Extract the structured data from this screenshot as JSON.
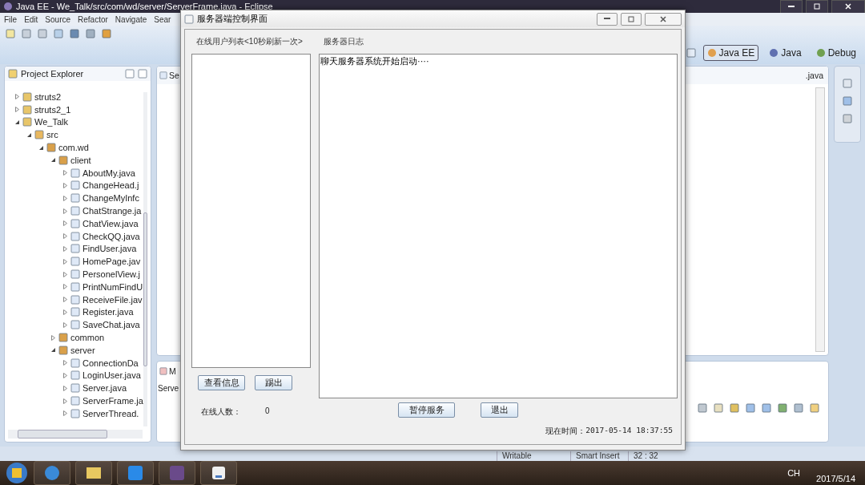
{
  "window": {
    "title": "Java EE - We_Talk/src/com/wd/server/ServerFrame.java - Eclipse"
  },
  "menu": [
    "File",
    "Edit",
    "Source",
    "Refactor",
    "Navigate",
    "Sear"
  ],
  "perspectives": [
    {
      "label": "Java EE",
      "selected": true
    },
    {
      "label": "Java",
      "selected": false
    },
    {
      "label": "Debug",
      "selected": false
    }
  ],
  "project_explorer": {
    "title": "Project Explorer",
    "tree": [
      {
        "label": "struts2",
        "kind": "project",
        "expanded": false
      },
      {
        "label": "struts2_1",
        "kind": "project",
        "expanded": false
      },
      {
        "label": "We_Talk",
        "kind": "project",
        "expanded": true,
        "children": [
          {
            "label": "src",
            "kind": "source",
            "expanded": true,
            "children": [
              {
                "label": "com.wd",
                "kind": "package",
                "expanded": true,
                "children": [
                  {
                    "label": "client",
                    "kind": "package",
                    "expanded": true,
                    "children": [
                      {
                        "label": "AboutMy.java",
                        "kind": "file",
                        "expanded": false
                      },
                      {
                        "label": "ChangeHead.j",
                        "kind": "file",
                        "expanded": false
                      },
                      {
                        "label": "ChangeMyInfc",
                        "kind": "file",
                        "expanded": false
                      },
                      {
                        "label": "ChatStrange.ja",
                        "kind": "file",
                        "expanded": false
                      },
                      {
                        "label": "ChatView.java",
                        "kind": "file",
                        "expanded": false
                      },
                      {
                        "label": "CheckQQ.java",
                        "kind": "file",
                        "expanded": false
                      },
                      {
                        "label": "FindUser.java",
                        "kind": "file",
                        "expanded": false
                      },
                      {
                        "label": "HomePage.jav",
                        "kind": "file",
                        "expanded": false
                      },
                      {
                        "label": "PersonelView.j",
                        "kind": "file",
                        "expanded": false
                      },
                      {
                        "label": "PrintNumFindU",
                        "kind": "file",
                        "expanded": false
                      },
                      {
                        "label": "ReceiveFile.jav",
                        "kind": "file",
                        "expanded": false
                      },
                      {
                        "label": "Register.java",
                        "kind": "file",
                        "expanded": false
                      },
                      {
                        "label": "SaveChat.java",
                        "kind": "file",
                        "expanded": false
                      }
                    ]
                  },
                  {
                    "label": "common",
                    "kind": "package",
                    "expanded": false
                  },
                  {
                    "label": "server",
                    "kind": "package",
                    "expanded": true,
                    "children": [
                      {
                        "label": "ConnectionDa",
                        "kind": "file",
                        "expanded": false
                      },
                      {
                        "label": "LoginUser.java",
                        "kind": "file",
                        "expanded": false
                      },
                      {
                        "label": "Server.java",
                        "kind": "file",
                        "expanded": false
                      },
                      {
                        "label": "ServerFrame.ja",
                        "kind": "file",
                        "expanded": false
                      },
                      {
                        "label": "ServerThread.",
                        "kind": "file",
                        "expanded": false
                      }
                    ]
                  }
                ]
              }
            ]
          }
        ]
      }
    ]
  },
  "editor": {
    "tabs": [
      "Se",
      ".java"
    ]
  },
  "bottom_panel": {
    "tab": "M",
    "text": "Serve"
  },
  "status_bar": [
    "Writable",
    "Smart Insert",
    "32 : 32"
  ],
  "taskbar": {
    "language": "CH",
    "date": "2017/5/14"
  },
  "dialog": {
    "title": "服务器端控制界面",
    "users_label": "在线用户列表<10秒刷新一次>",
    "log_label": "服务器日志",
    "log_text": "聊天服务器系统开始启动····",
    "user_buttons": [
      "查看信息",
      "踢出"
    ],
    "online_label": "在线人数：",
    "online_count": "0",
    "server_buttons": [
      "暂停服务",
      "退出"
    ],
    "time_label": "现在时间：",
    "time_value": "2017-05-14 18:37:55"
  }
}
